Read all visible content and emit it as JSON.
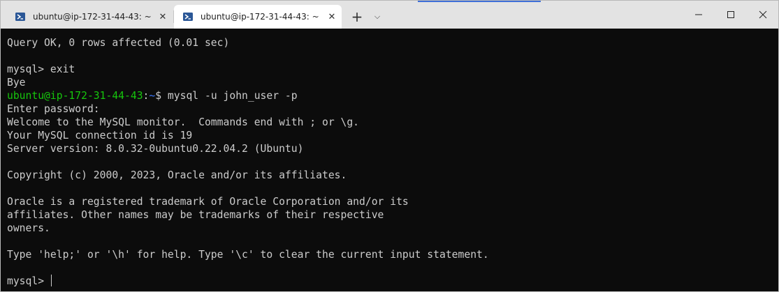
{
  "tabs": [
    {
      "label": "ubuntu@ip-172-31-44-43: ~",
      "close": "✕",
      "icon": "powershell-icon"
    },
    {
      "label": "ubuntu@ip-172-31-44-43: ~",
      "close": "✕",
      "icon": "powershell-icon"
    }
  ],
  "titlebar": {
    "new_tab": "+",
    "dropdown": "⌵"
  },
  "colors": {
    "prompt_user": "#16c60c",
    "prompt_path": "#3b78ff",
    "text": "#cccccc",
    "background": "#0c0c0c"
  },
  "terminal": {
    "lines": [
      "Query OK, 0 rows affected (0.01 sec)",
      "",
      "mysql> exit",
      "Bye"
    ],
    "prompt": {
      "user_host": "ubuntu@ip-172-31-44-43",
      "colon": ":",
      "path": "~",
      "symbol": "$ ",
      "command": "mysql -u john_user -p"
    },
    "output": [
      "Enter password:",
      "Welcome to the MySQL monitor.  Commands end with ; or \\g.",
      "Your MySQL connection id is 19",
      "Server version: 8.0.32-0ubuntu0.22.04.2 (Ubuntu)",
      "",
      "Copyright (c) 2000, 2023, Oracle and/or its affiliates.",
      "",
      "Oracle is a registered trademark of Oracle Corporation and/or its",
      "affiliates. Other names may be trademarks of their respective",
      "owners.",
      "",
      "Type 'help;' or '\\h' for help. Type '\\c' to clear the current input statement.",
      ""
    ],
    "current_prompt": "mysql> "
  }
}
